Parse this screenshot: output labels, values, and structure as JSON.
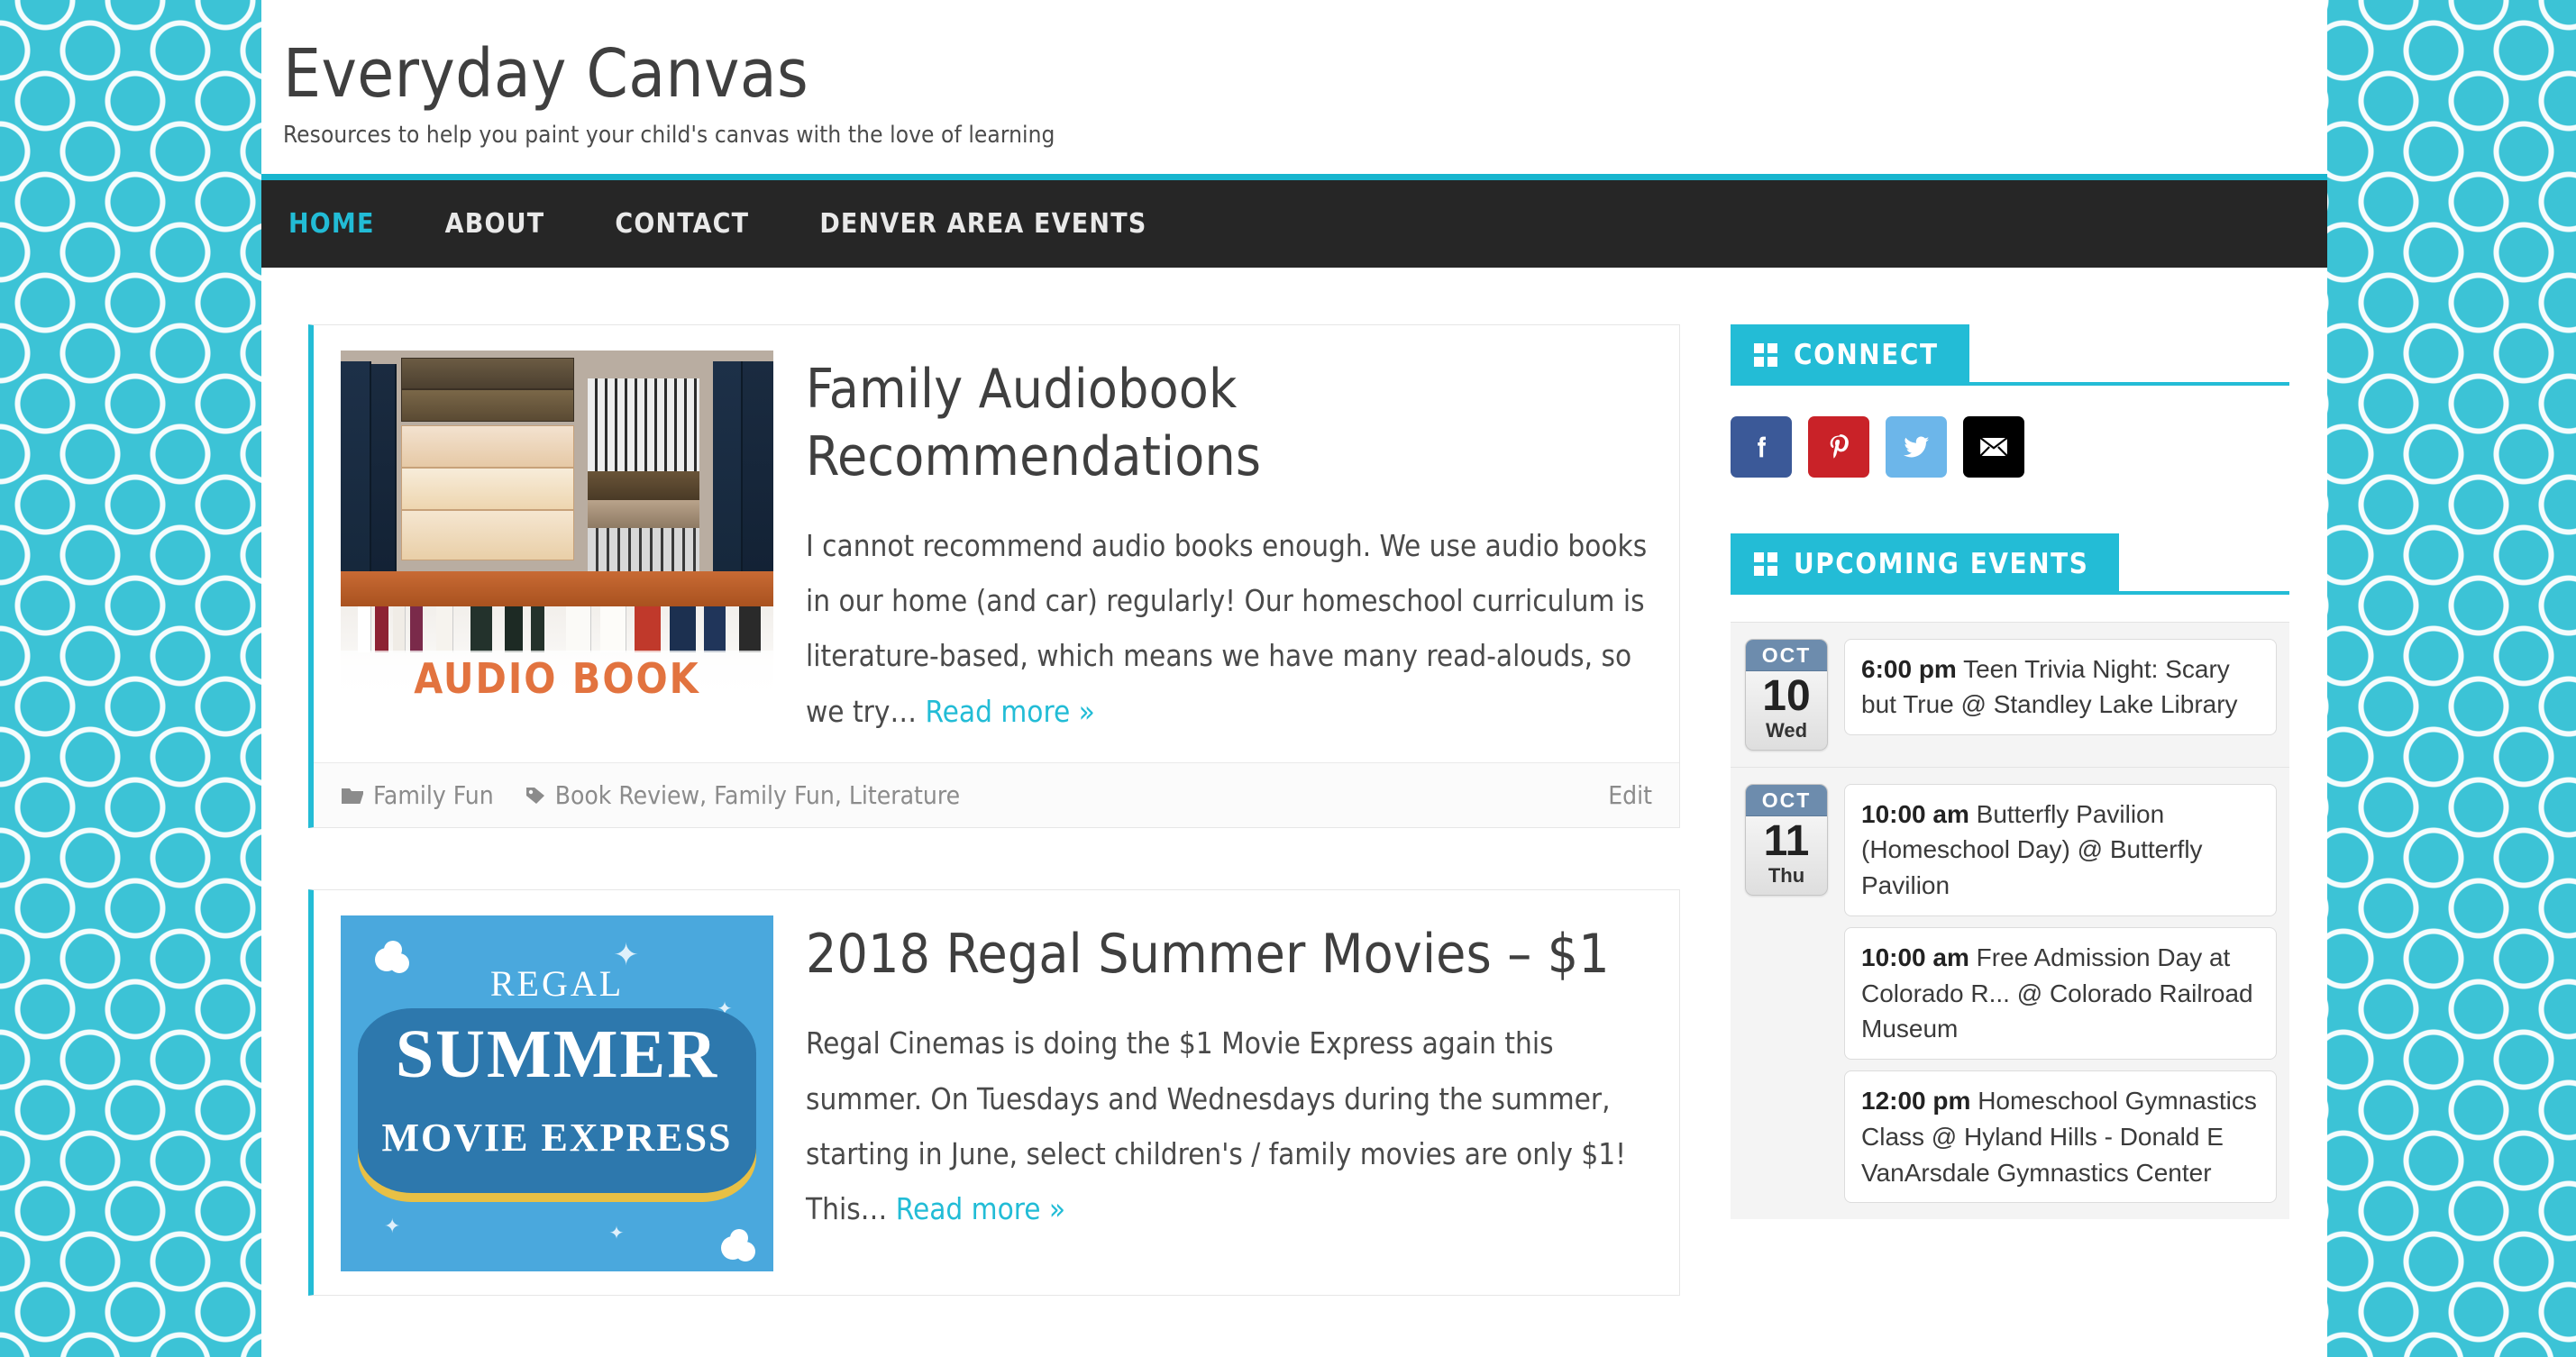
{
  "theme": {
    "accent": "#23bcd6",
    "nav_bg": "#262626",
    "background": "#3cc3d6",
    "date_badge_header": "#6d8cad"
  },
  "header": {
    "title": "Everyday Canvas",
    "tagline": "Resources to help you paint your child's canvas with the love of learning"
  },
  "nav": {
    "items": [
      {
        "label": "HOME",
        "active": true
      },
      {
        "label": "ABOUT",
        "active": false
      },
      {
        "label": "CONTACT",
        "active": false
      },
      {
        "label": "DENVER AREA EVENTS",
        "active": false
      }
    ]
  },
  "posts": [
    {
      "title": "Family Audiobook Recommendations",
      "excerpt": "I cannot recommend audio books enough. We use audio books in our home (and car) regularly! Our homeschool curriculum is literature-based, which means we have many read-alouds, so we try… ",
      "read_more": "Read more »",
      "category": "Family Fun",
      "tags": "Book Review, Family Fun, Literature",
      "edit": "Edit",
      "thumb": "bookshelf-audio-book",
      "thumb_caption": "AUDIO BOOK"
    },
    {
      "title": "2018 Regal Summer Movies – $1",
      "excerpt": "Regal Cinemas is doing the $1 Movie Express again this summer. On Tuesdays and Wednesdays during the summer, starting in June, select children's / family movies are only $1! This… ",
      "read_more": "Read more »",
      "thumb": "regal-summer-movie-express",
      "thumb_brand": "REGAL",
      "thumb_line1": "SUMMER",
      "thumb_line2": "MOVIE EXPRESS"
    }
  ],
  "sidebar": {
    "connect": {
      "title": "Connect",
      "socials": [
        {
          "name": "facebook",
          "color": "#3b5998"
        },
        {
          "name": "pinterest",
          "color": "#c92228"
        },
        {
          "name": "twitter",
          "color": "#6cb6ea"
        },
        {
          "name": "email",
          "color": "#000000"
        }
      ]
    },
    "events": {
      "title": "Upcoming Events",
      "days": [
        {
          "month": "OCT",
          "day": "10",
          "weekday": "Wed",
          "items": [
            {
              "time": "6:00 pm",
              "text": "Teen Trivia Night: Scary but True @ Standley Lake Library"
            }
          ]
        },
        {
          "month": "OCT",
          "day": "11",
          "weekday": "Thu",
          "items": [
            {
              "time": "10:00 am",
              "text": "Butterfly Pavilion (Homeschool Day) @ Butterfly Pavilion"
            },
            {
              "time": "10:00 am",
              "text": "Free Admission Day at Colorado R... @ Colorado Railroad Museum"
            },
            {
              "time": "12:00 pm",
              "text": "Homeschool Gymnastics Class @ Hyland Hills - Donald E VanArsdale Gymnastics Center"
            }
          ]
        }
      ]
    }
  }
}
